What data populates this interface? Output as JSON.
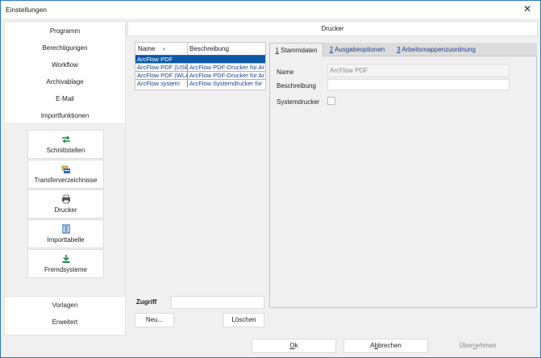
{
  "window": {
    "title": "Einstellungen",
    "close_glyph": "✕"
  },
  "nav": {
    "items": [
      "Programm",
      "Berechtigungen",
      "Workflow",
      "Archivablage",
      "E-Mail",
      "Importfunktionen"
    ],
    "modules": [
      {
        "label": "Schnittstellen",
        "icon": "arrows-exchange-icon"
      },
      {
        "label": "Transferverzeichnisse",
        "icon": "folders-icon"
      },
      {
        "label": "Drucker",
        "icon": "printer-icon"
      },
      {
        "label": "Importtabelle",
        "icon": "table-columns-icon"
      },
      {
        "label": "Fremdsysteme",
        "icon": "download-icon"
      }
    ],
    "bottom_items": [
      "Vorlagen",
      "Erweitert"
    ]
  },
  "header": {
    "title": "Drucker"
  },
  "list": {
    "columns": [
      "Name",
      "Beschreibung"
    ],
    "sort_glyph": "▼",
    "rows": [
      {
        "name": "ArcFlow PDF",
        "desc": ""
      },
      {
        "name": "ArcFlow PDF (USB)",
        "desc": "ArcFlow PDF-Drucker für Ar"
      },
      {
        "name": "ArcFlow PDF (WLAN)",
        "desc": "ArcFlow PDF-Drucker für Ar"
      },
      {
        "name": "ArcFlow system",
        "desc": "ArcFlow Systemdrucker für"
      }
    ]
  },
  "access": {
    "label": "Zugriff",
    "value": ""
  },
  "list_buttons": {
    "new": "Neu...",
    "delete": "Löschen"
  },
  "tabs": [
    {
      "key": "1",
      "label": " Stammdaten"
    },
    {
      "key": "2",
      "label": " Ausgabeoptionen"
    },
    {
      "key": "3",
      "label": " Arbeitsmappenzuordnung"
    }
  ],
  "form": {
    "name_label": "Name",
    "name_value": "ArcFlow PDF",
    "description_label": "Beschreibung",
    "description_value": "",
    "system_label": "Systemdrucker"
  },
  "footer": {
    "ok": {
      "key": "O",
      "rest": "k"
    },
    "cancel": {
      "pre": "A",
      "key": "b",
      "rest": "brechen"
    },
    "apply": {
      "pre": "Über",
      "key": "n",
      "rest": "ehmen"
    }
  },
  "colors": {
    "accent": "#0c5aa6",
    "icon_green": "#1d8a4e",
    "icon_blue": "#2b6cc4"
  }
}
